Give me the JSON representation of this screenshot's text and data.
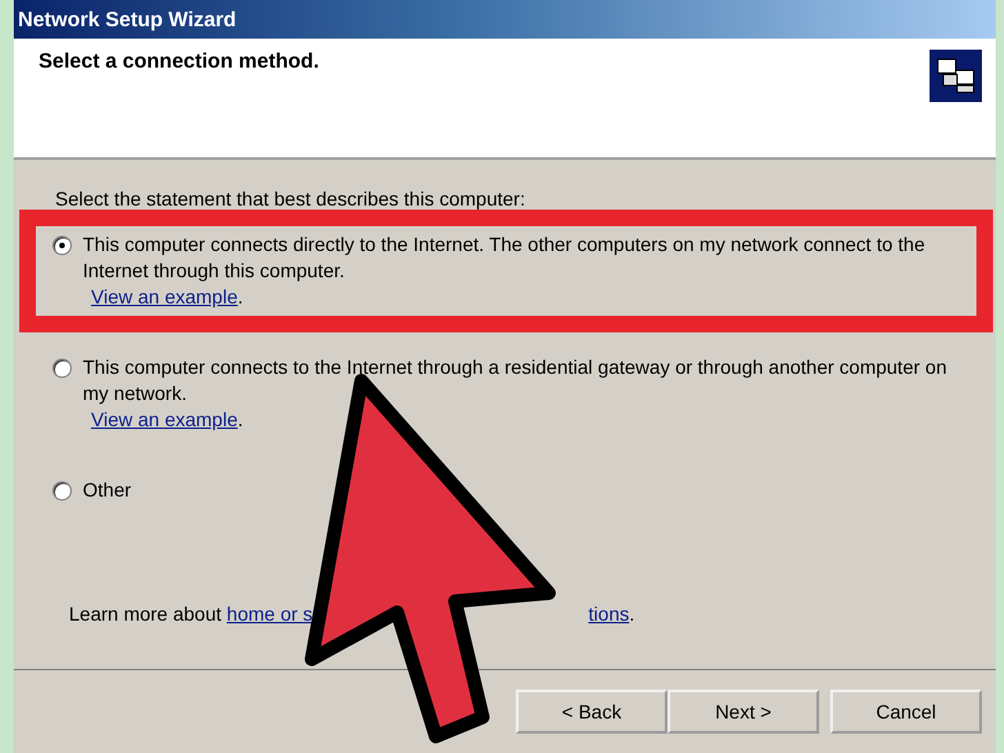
{
  "window": {
    "title": "Network Setup Wizard"
  },
  "header": {
    "heading": "Select a connection method."
  },
  "prompt": "Select the statement that best describes this computer:",
  "options": [
    {
      "label": "This computer connects directly to the Internet. The other computers on my network connect to the Internet through this computer.",
      "link": "View an example",
      "after": ".",
      "selected": true,
      "highlighted": true
    },
    {
      "label": "This computer connects to the Internet through a residential gateway or through another computer on my network.",
      "link": "View an example",
      "after": ".",
      "selected": false,
      "highlighted": false
    },
    {
      "label": "Other",
      "selected": false,
      "highlighted": false
    }
  ],
  "learn_more": {
    "prefix": "Learn more about",
    "link_start": "home or s",
    "link_end": "tions",
    "suffix": "."
  },
  "buttons": [
    {
      "label": "< Back"
    },
    {
      "label": "Next >"
    },
    {
      "label": "Cancel"
    }
  ]
}
